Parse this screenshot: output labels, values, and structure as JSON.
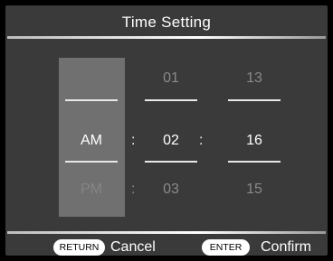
{
  "title": "Time Setting",
  "picker": {
    "period": {
      "above": "",
      "selected": "AM",
      "below": "PM"
    },
    "hour": {
      "above": "01",
      "selected": "02",
      "below": "03"
    },
    "minute": {
      "above": "13",
      "selected": "16",
      "below": "15"
    },
    "separator": ":"
  },
  "footer": {
    "return_key": "RETURN",
    "return_label": "Cancel",
    "enter_key": "ENTER",
    "enter_label": "Confirm"
  }
}
